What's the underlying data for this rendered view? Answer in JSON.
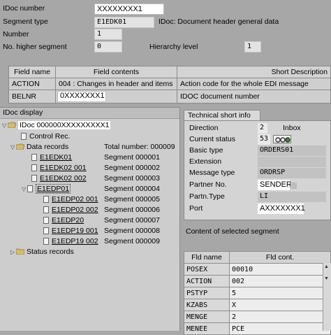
{
  "header": {
    "idoc_number_label": "IDoc number",
    "idoc_number_value": "XXXXXXXX1",
    "segment_type_label": "Segment type",
    "segment_type_value": "E1EDK01",
    "segment_type_desc": "IDoc: Document header general data",
    "number_label": "Number",
    "number_value": "1",
    "higher_segment_label": "No. higher segment",
    "higher_segment_value": "0",
    "hierarchy_label": "Hierarchy level",
    "hierarchy_value": "1"
  },
  "field_table": {
    "columns": [
      "Field name",
      "Field contents",
      "Short Description"
    ],
    "rows": [
      {
        "name": "ACTION",
        "contents": "004 : Changes in header and items",
        "desc": "Action code for the whole EDI message"
      },
      {
        "name": "BELNR",
        "contents": "0XXXXXXX1",
        "desc": "IDOC document number"
      }
    ]
  },
  "tree": {
    "title": "IDoc display",
    "root": "IDoc 000000XXXXXXXXX1",
    "control": "Control Rec.",
    "data_records": "Data records",
    "total": "Total number: 000009",
    "segments": [
      {
        "name": "E1EDK01",
        "seg": "Segment 000001"
      },
      {
        "name": "E1EDK02 001",
        "seg": "Segment 000002"
      },
      {
        "name": "E1EDK02 002",
        "seg": "Segment 000003"
      },
      {
        "name": "E1EDP01",
        "seg": "Segment 000004"
      },
      {
        "name": "E1EDP02 001",
        "seg": "Segment 000005"
      },
      {
        "name": "E1EDP02 002",
        "seg": "Segment 000006"
      },
      {
        "name": "E1EDP20",
        "seg": "Segment 000007"
      },
      {
        "name": "E1EDP19 001",
        "seg": "Segment 000008"
      },
      {
        "name": "E1EDP19 002",
        "seg": "Segment 000009"
      }
    ],
    "status": "Status records"
  },
  "tech": {
    "tab": "Technical short info",
    "direction_label": "Direction",
    "direction_value": "2",
    "direction_text": "Inbox",
    "status_label": "Current status",
    "status_value": "53",
    "basic_type_label": "Basic type",
    "basic_type_value": "ORDERS01",
    "extension_label": "Extension",
    "extension_value": "",
    "message_type_label": "Message type",
    "message_type_value": "ORDRSP",
    "partner_label": "Partner No.",
    "partner_value": "SENDER",
    "partn_type_label": "Partn.Type",
    "partn_type_value": "LI",
    "port_label": "Port",
    "port_value": "AXXXXXXX1"
  },
  "content": {
    "title": "Content of selected segment",
    "columns": [
      "Fld name",
      "Fld cont."
    ],
    "rows": [
      {
        "name": "POSEX",
        "value": "00010"
      },
      {
        "name": "ACTION",
        "value": "002"
      },
      {
        "name": "PSTYP",
        "value": "5"
      },
      {
        "name": "KZABS",
        "value": "X"
      },
      {
        "name": "MENGE",
        "value": "2"
      },
      {
        "name": "MENEE",
        "value": "PCE"
      }
    ]
  },
  "colors": {
    "status_green": "#2e8b2e",
    "folder": "#c9a64a"
  }
}
